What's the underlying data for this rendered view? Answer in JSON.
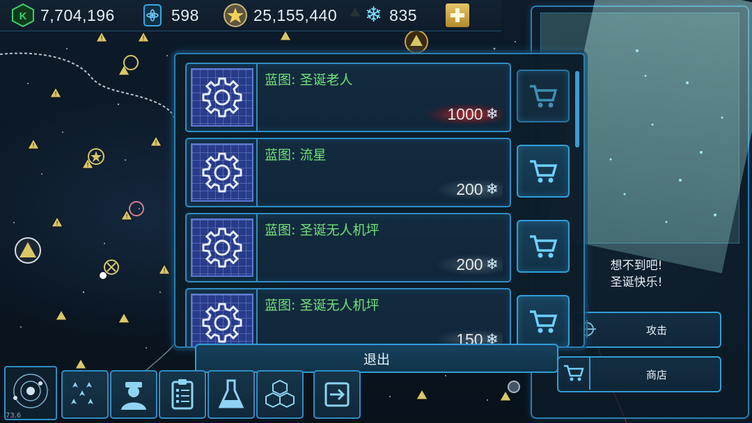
{
  "resources": {
    "credits": "7,704,196",
    "energy": "598",
    "stars": "25,155,440",
    "snowflakes": "835"
  },
  "shop": {
    "items": [
      {
        "name": "蓝图: 圣诞老人",
        "price": "1000",
        "highlight": true,
        "buy_enabled": false
      },
      {
        "name": "蓝图: 流星",
        "price": "200",
        "highlight": false,
        "buy_enabled": true
      },
      {
        "name": "蓝图: 圣诞无人机坪",
        "price": "200",
        "highlight": false,
        "buy_enabled": true
      },
      {
        "name": "蓝图: 圣诞无人机坪",
        "price": "150",
        "highlight": false,
        "buy_enabled": true
      }
    ],
    "exit_label": "退出"
  },
  "npc": {
    "line1": "想不到吧!",
    "line2": "圣诞快乐!"
  },
  "side_buttons": {
    "attack_label": "攻击",
    "shop_label": "商店"
  },
  "toolbar": {
    "icons": [
      "fleet-icon",
      "commander-icon",
      "missions-icon",
      "research-icon",
      "resources-icon",
      "exit-icon"
    ]
  },
  "fps": "73.6",
  "colors": {
    "accent": "#2f9fd8",
    "item_name": "#6fe07a",
    "blueprint": "#283b8a"
  }
}
